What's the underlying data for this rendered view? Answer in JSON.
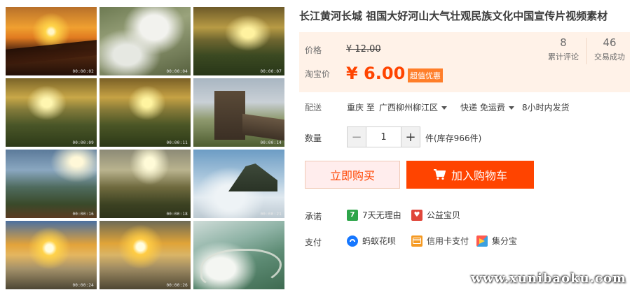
{
  "thumbnails": [
    {
      "timestamp": "00:00:02",
      "icon": "sunrise-mountain-frame"
    },
    {
      "timestamp": "00:00:04",
      "icon": "cloud-valley-frame"
    },
    {
      "timestamp": "00:00:07",
      "icon": "golden-fields-frame"
    },
    {
      "timestamp": "00:00:09",
      "icon": "sunlit-fields-frame"
    },
    {
      "timestamp": "00:00:11",
      "icon": "sunlit-fields-frame"
    },
    {
      "timestamp": "00:00:14",
      "icon": "great-wall-frame"
    },
    {
      "timestamp": "00:00:16",
      "icon": "mountain-rays-frame"
    },
    {
      "timestamp": "00:00:18",
      "icon": "mountain-rays-frame"
    },
    {
      "timestamp": "00:00:21",
      "icon": "sea-of-clouds-frame"
    },
    {
      "timestamp": "00:00:24",
      "icon": "sunrise-clouds-frame"
    },
    {
      "timestamp": "00:00:26",
      "icon": "sunrise-clouds-frame"
    },
    {
      "timestamp": "",
      "icon": "river-valley-frame"
    }
  ],
  "product": {
    "title": "长江黄河长城 祖国大好河山大气壮观民族文化中国宣传片视频素材"
  },
  "price": {
    "original_label": "价格",
    "original_value": "¥ 12.00",
    "taobao_label": "淘宝价",
    "taobao_value": "¥ 6.00",
    "promo_tag": "超值优惠"
  },
  "stats": {
    "reviews_count": "8",
    "reviews_label": "累计评论",
    "sales_count": "46",
    "sales_label": "交易成功"
  },
  "delivery": {
    "label": "配送",
    "from": "重庆 至",
    "to": "广西柳州柳江区",
    "method": "快递 免运费",
    "ship_time": "8小时内发货"
  },
  "quantity": {
    "label": "数量",
    "minus": "−",
    "value": "1",
    "plus": "+",
    "stock_text": "件(库存966件)"
  },
  "actions": {
    "buy_now": "立即购买",
    "add_to_cart": "加入购物车"
  },
  "promise": {
    "label": "承诺",
    "items": [
      {
        "text": "7天无理由",
        "icon_text": "7",
        "color": "#2ea54a"
      },
      {
        "text": "公益宝贝",
        "icon_text": "♥",
        "color": "#e0463a"
      }
    ]
  },
  "payment": {
    "label": "支付",
    "items": [
      {
        "text": "蚂蚁花呗",
        "color": "#1677ff"
      },
      {
        "text": "信用卡支付",
        "color": "#f59a23"
      },
      {
        "text": "集分宝",
        "color": "#3aa0e0"
      }
    ]
  },
  "watermark": "www.xunibaoku.com"
}
